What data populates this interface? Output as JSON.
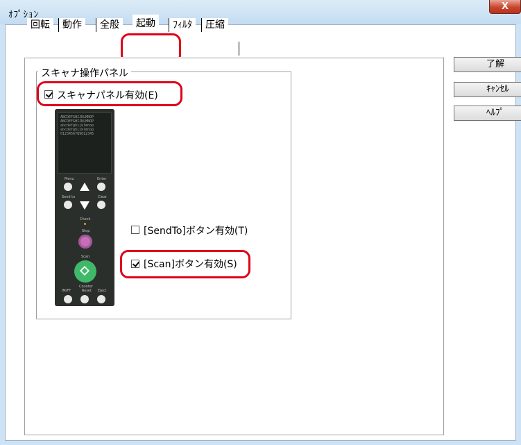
{
  "window": {
    "title": "ｵﾌﾟｼｮﾝ",
    "close_label": "X"
  },
  "tabs": [
    {
      "label": "回転"
    },
    {
      "label": "動作"
    },
    {
      "label": "全般"
    },
    {
      "label": "起動"
    },
    {
      "label": "ﾌｨﾙﾀ"
    },
    {
      "label": "圧縮"
    }
  ],
  "buttons": {
    "ok": "了解",
    "cancel": "ｷｬﾝｾﾙ",
    "help": "ﾍﾙﾌﾟ"
  },
  "group": {
    "title": "スキャナ操作パネル",
    "enable_panel": {
      "label": "スキャナパネル有効(E)",
      "checked": true
    },
    "sendto": {
      "label": "[SendTo]ボタン有効(T)",
      "checked": false
    },
    "scan": {
      "label": "[Scan]ボタン有効(S)",
      "checked": true
    }
  },
  "device": {
    "lcd_lines": [
      "ABCDEFGHIJKLMNOP",
      "ABCDEFGHIJKLMNOP",
      "abcdefghijklmnop",
      "abcdefghijklmnop",
      "0123456789012345"
    ],
    "labels": {
      "menu": "Menu",
      "enter": "Enter",
      "send_to": "Send to",
      "clear": "Clear",
      "check": "Check",
      "stop": "Stop",
      "scan": "Scan",
      "iwff": "iM/FF",
      "counter": "Counter",
      "reset": "Reset",
      "eject": "Eject"
    }
  },
  "colors": {
    "highlight": "#e0001a",
    "scan_button": "#3fb86a",
    "stop_button": "#c46fb6"
  }
}
